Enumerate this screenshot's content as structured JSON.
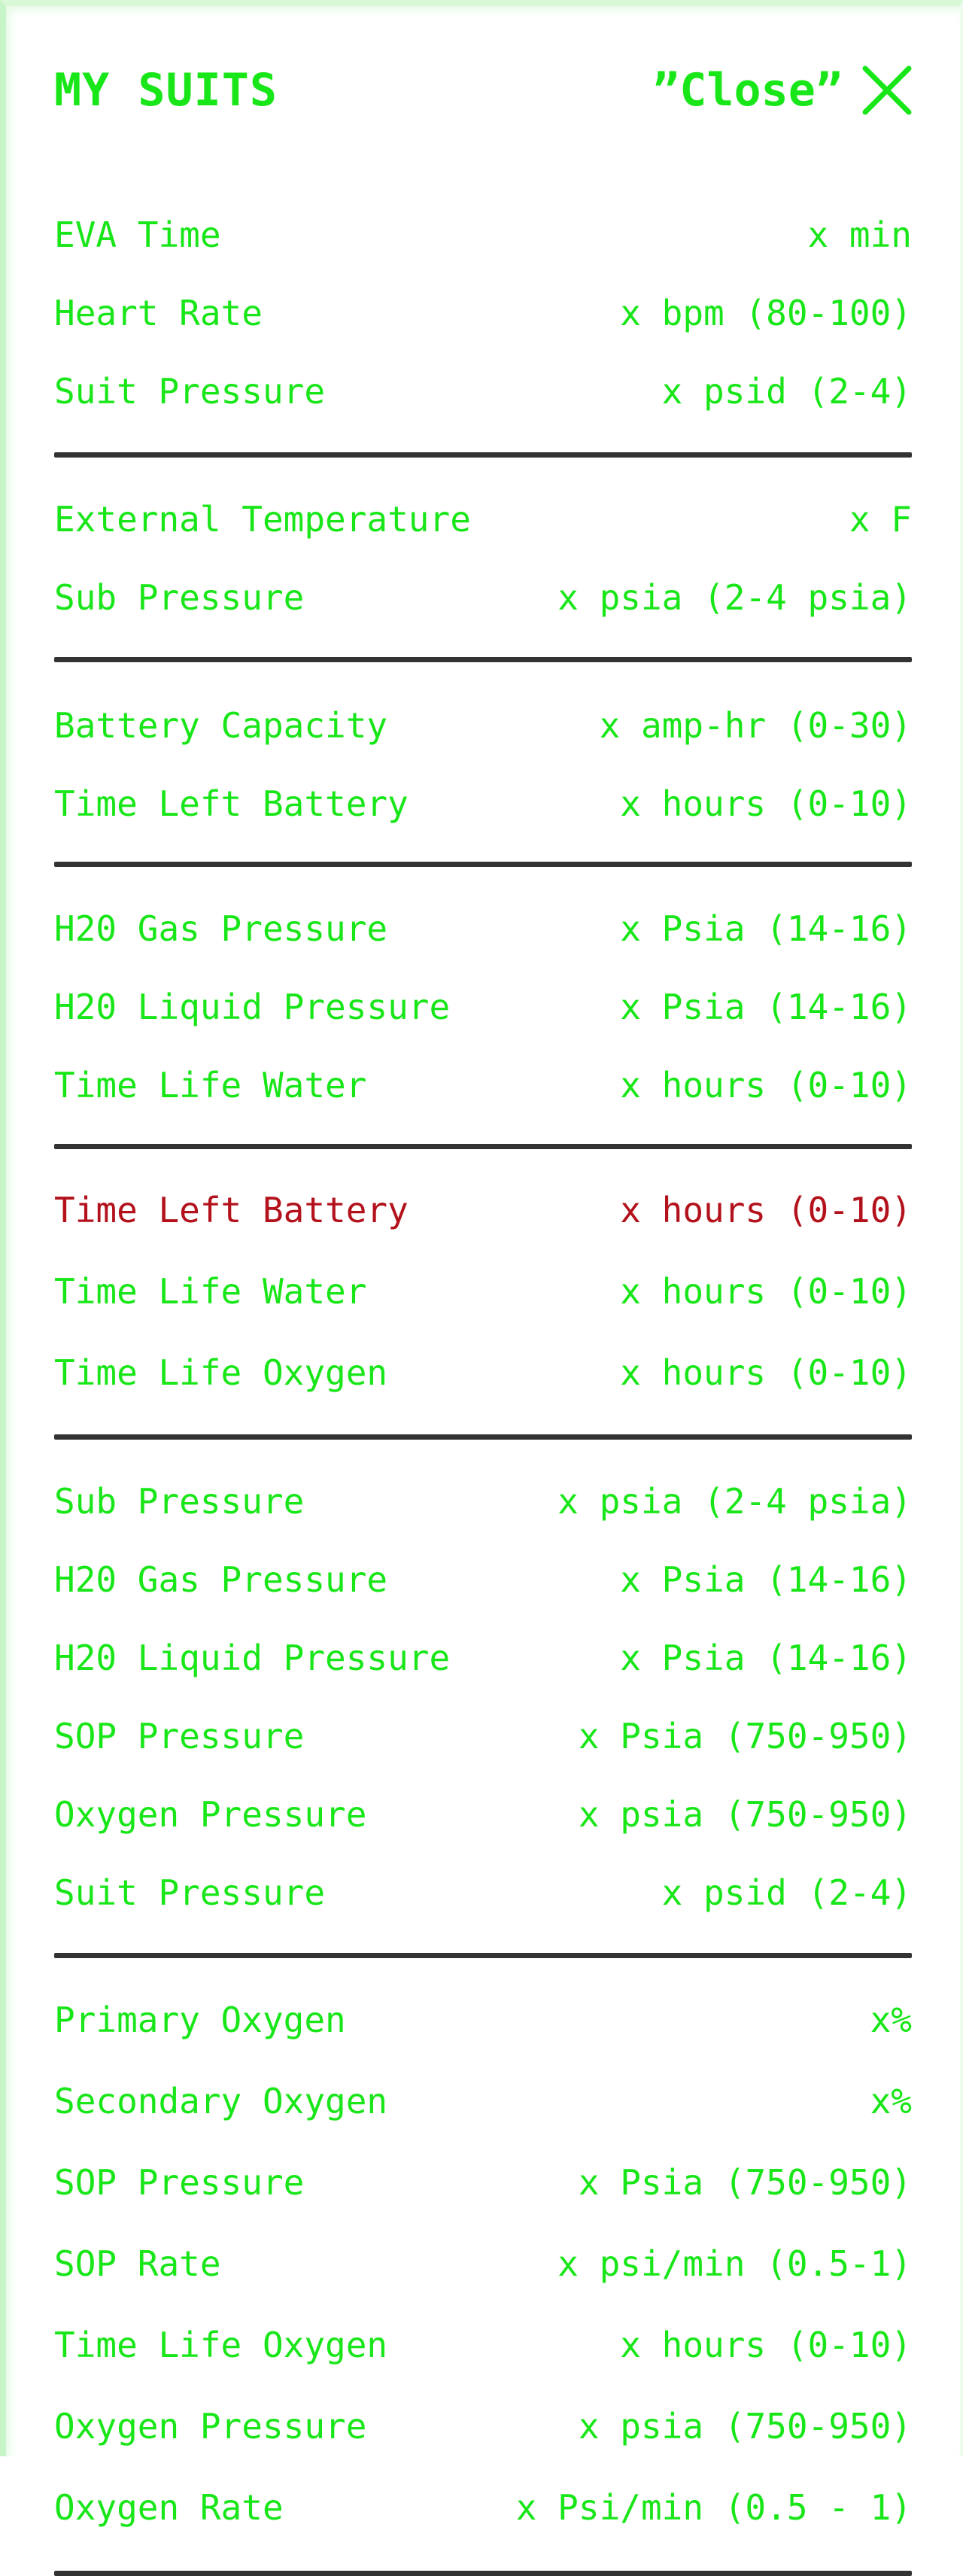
{
  "header": {
    "title": "MY SUITS",
    "close_label": "”Close”"
  },
  "colors": {
    "accent": "#19e619",
    "alert": "#b3121c",
    "divider": "#333333"
  },
  "sections": [
    {
      "rows": [
        {
          "label": "EVA Time",
          "value": "x min"
        },
        {
          "label": "Heart Rate",
          "value": "x bpm (80-100)"
        },
        {
          "label": "Suit Pressure",
          "value": "x psid (2-4)"
        }
      ]
    },
    {
      "rows": [
        {
          "label": "External Temperature",
          "value": "x F"
        },
        {
          "label": "Sub Pressure",
          "value": "x psia (2-4 psia)"
        }
      ]
    },
    {
      "rows": [
        {
          "label": "Battery Capacity",
          "value": "x amp-hr (0-30)"
        },
        {
          "label": "Time Left Battery",
          "value": "x hours (0-10)"
        }
      ]
    },
    {
      "rows": [
        {
          "label": "H20 Gas Pressure",
          "value": "x Psia (14-16)"
        },
        {
          "label": "H20 Liquid Pressure",
          "value": "x Psia (14-16)"
        },
        {
          "label": "Time Life Water",
          "value": "x hours (0-10)"
        }
      ]
    },
    {
      "rows": [
        {
          "label": "Time Left Battery",
          "value": "x hours (0-10)",
          "alert": true
        },
        {
          "label": "Time Life Water",
          "value": "x hours (0-10)"
        },
        {
          "label": "Time Life Oxygen",
          "value": "x hours (0-10)"
        }
      ]
    },
    {
      "rows": [
        {
          "label": "Sub Pressure",
          "value": "x psia (2-4 psia)"
        },
        {
          "label": "H20 Gas Pressure",
          "value": "x Psia (14-16)"
        },
        {
          "label": "H20 Liquid Pressure",
          "value": "x Psia (14-16)"
        },
        {
          "label": "SOP Pressure",
          "value": "x Psia (750-950)"
        },
        {
          "label": "Oxygen Pressure",
          "value": "x psia (750-950)"
        },
        {
          "label": "Suit Pressure",
          "value": "x psid (2-4)"
        }
      ]
    },
    {
      "rows": [
        {
          "label": "Primary Oxygen",
          "value": "x%"
        },
        {
          "label": "Secondary Oxygen",
          "value": "x%"
        },
        {
          "label": "SOP Pressure",
          "value": "x Psia (750-950)"
        },
        {
          "label": "SOP Rate",
          "value": "x psi/min (0.5-1)"
        },
        {
          "label": "Time Life Oxygen",
          "value": "x hours (0-10)"
        },
        {
          "label": "Oxygen Pressure",
          "value": "x psia (750-950)"
        },
        {
          "label": "Oxygen Rate",
          "value": "x Psi/min (0.5 - 1)"
        }
      ]
    }
  ]
}
